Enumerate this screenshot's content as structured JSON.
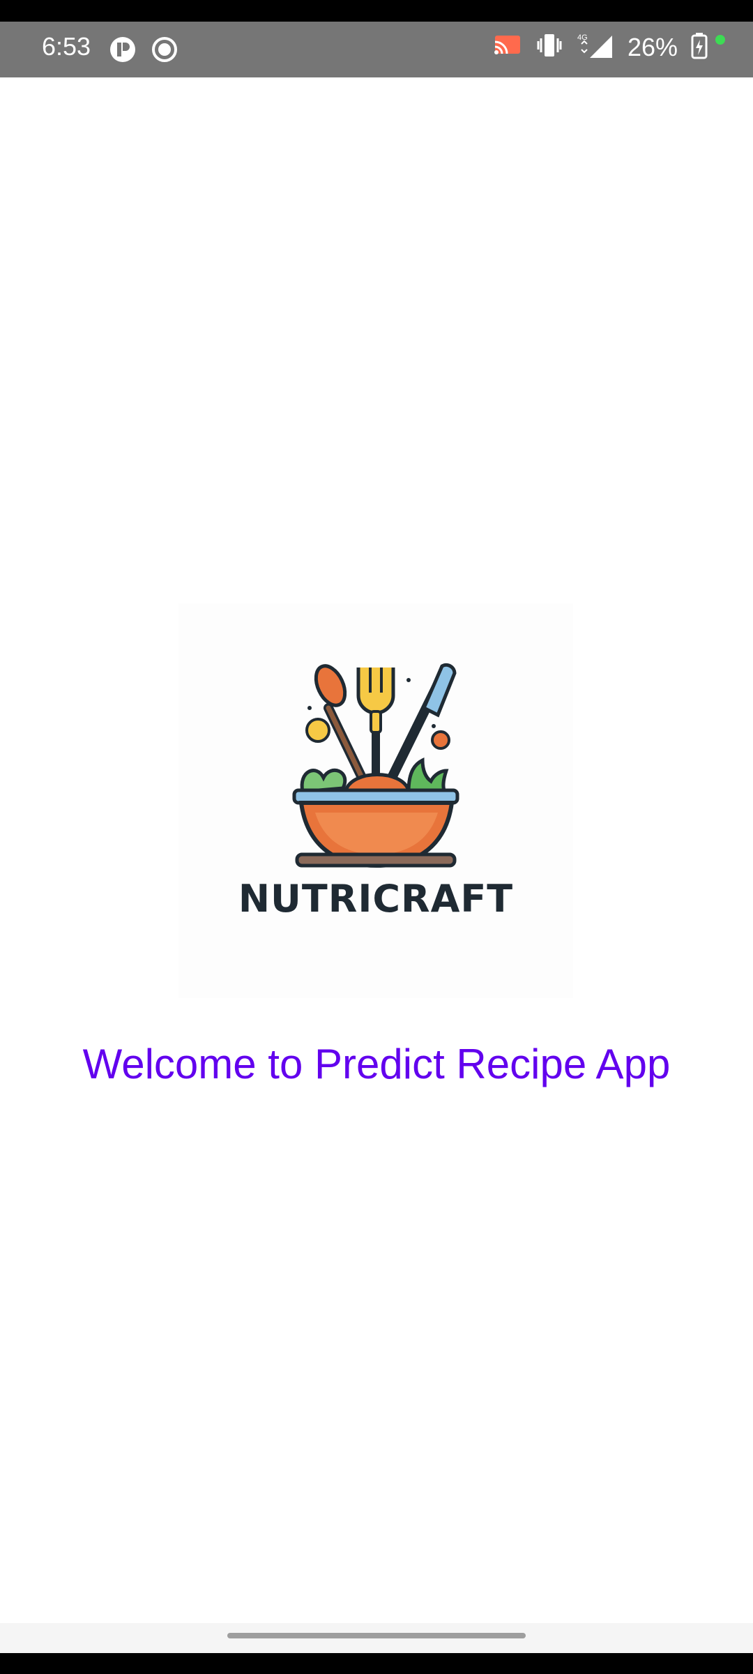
{
  "status_bar": {
    "time": "6:53",
    "battery": "26%",
    "network": "4G",
    "icons": [
      "app-notification-icon",
      "record-icon",
      "cast-icon",
      "vibrate-icon",
      "signal-icon",
      "battery-charging-icon"
    ]
  },
  "app": {
    "brand": "NUTRICRAFT",
    "welcome": "Welcome to Predict Recipe App",
    "welcome_color": "#6200ee"
  }
}
